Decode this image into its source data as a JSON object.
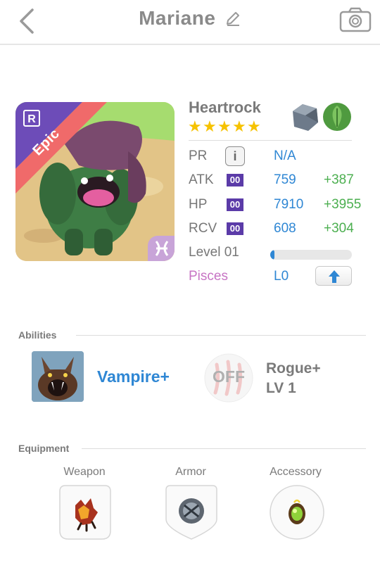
{
  "header": {
    "title": "Mariane"
  },
  "monster": {
    "name": "Heartrock",
    "rarity_label": "Epic",
    "stars": [
      "★",
      "★",
      "★",
      "★",
      "★"
    ],
    "elements": [
      "earth-icon",
      "wood-leaf-icon"
    ],
    "rows": {
      "pr": {
        "label": "PR",
        "value": "N/A"
      },
      "atk": {
        "label": "ATK",
        "tag": "00",
        "value": "759",
        "bonus": "+387"
      },
      "hp": {
        "label": "HP",
        "tag": "00",
        "value": "7910",
        "bonus": "+3955"
      },
      "rcv": {
        "label": "RCV",
        "tag": "00",
        "value": "608",
        "bonus": "+304"
      },
      "level": {
        "label": "Level 01",
        "progress": 0.02
      },
      "sign": {
        "label": "Pisces",
        "value": "L0"
      }
    }
  },
  "abilities": {
    "heading": "Abilities",
    "active": {
      "name": "Vampire+"
    },
    "passive": {
      "status": "OFF",
      "name": "Rogue+",
      "level": "LV 1"
    }
  },
  "equipment": {
    "heading": "Equipment",
    "slots": [
      {
        "label": "Weapon",
        "icon": "claw-weapon-icon"
      },
      {
        "label": "Armor",
        "icon": "armor-orb-icon"
      },
      {
        "label": "Accessory",
        "icon": "green-gem-accessory-icon"
      }
    ]
  },
  "colors": {
    "accent_blue": "#2f87d4",
    "bonus_green": "#4caf50",
    "epic_red": "#f06a6a",
    "tag_purple": "#5b3ba8",
    "pisces_pink": "#c774c4"
  }
}
